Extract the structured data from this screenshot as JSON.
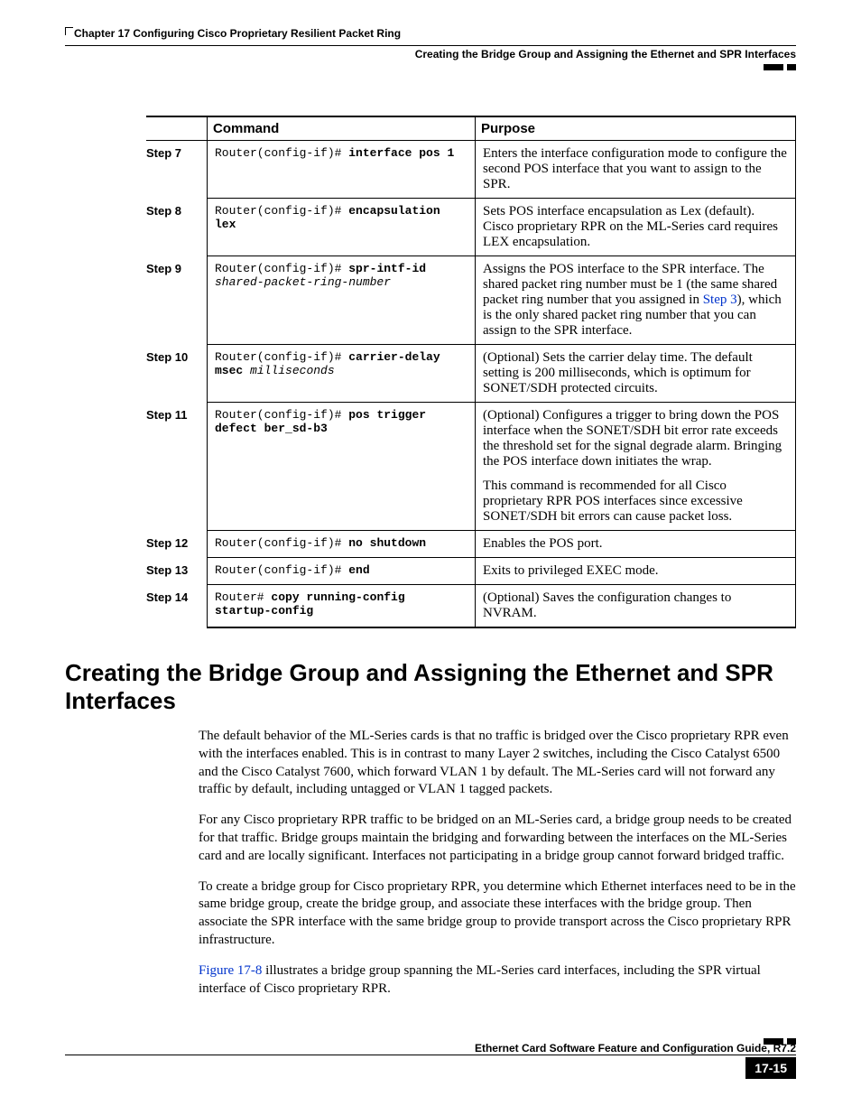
{
  "header": {
    "chapter": "Chapter 17    Configuring Cisco Proprietary Resilient Packet Ring",
    "section": "Creating the Bridge Group and Assigning the Ethernet and SPR Interfaces"
  },
  "table": {
    "headers": {
      "command": "Command",
      "purpose": "Purpose"
    },
    "steps": [
      {
        "step": "Step 7",
        "prompt": "Router(config-if)# ",
        "bold": "interface pos 1",
        "italic": "",
        "purpose": "Enters the interface configuration mode to configure the second POS interface that you want to assign to the SPR."
      },
      {
        "step": "Step 8",
        "prompt": "Router(config-if)# ",
        "bold": "encapsulation lex",
        "italic": "",
        "purpose": "Sets POS interface encapsulation as Lex (default). Cisco proprietary RPR on the ML-Series card requires LEX encapsulation."
      },
      {
        "step": "Step 9",
        "prompt": "Router(config-if)# ",
        "bold": "spr-intf-id",
        "italic": "shared-packet-ring-number",
        "purpose_parts": {
          "pre": "Assigns the POS interface to the SPR interface. The shared packet ring number must be 1 (the same shared packet ring number that you assigned in ",
          "link": "Step 3",
          "post": "), which is the only shared packet ring number that you can assign to the SPR interface."
        }
      },
      {
        "step": "Step 10",
        "prompt": "Router(config-if)# ",
        "bold": "carrier-delay msec",
        "italic": "milliseconds",
        "purpose": "(Optional) Sets the carrier delay time. The default setting is 200 milliseconds, which is optimum for SONET/SDH protected circuits."
      },
      {
        "step": "Step 11",
        "prompt": "Router(config-if)# ",
        "bold": "pos trigger defect ber_sd-b3",
        "italic": "",
        "purpose": "(Optional) Configures a trigger to bring down the POS interface when the SONET/SDH bit error rate exceeds the threshold set for the signal degrade alarm. Bringing the POS interface down initiates the wrap.",
        "purpose2": "This command is recommended for all Cisco proprietary RPR POS interfaces since excessive SONET/SDH bit errors can cause packet loss."
      },
      {
        "step": "Step 12",
        "prompt": "Router(config-if)# ",
        "bold": "no shutdown",
        "italic": "",
        "purpose": "Enables the POS port."
      },
      {
        "step": "Step 13",
        "prompt": "Router(config-if)# ",
        "bold": "end",
        "italic": "",
        "purpose": "Exits to privileged EXEC mode."
      },
      {
        "step": "Step 14",
        "prompt": "Router# ",
        "bold": "copy running-config startup-config",
        "italic": "",
        "purpose": "(Optional) Saves the configuration changes to NVRAM."
      }
    ]
  },
  "heading": "Creating the Bridge Group and Assigning the Ethernet and SPR Interfaces",
  "paragraphs": {
    "p1": "The default behavior of the ML-Series cards is that no traffic is bridged over the Cisco proprietary RPR even with the interfaces enabled. This is in contrast to many Layer 2 switches, including the Cisco Catalyst 6500 and the Cisco Catalyst 7600, which forward VLAN 1 by default. The ML-Series card will not forward any traffic by default, including untagged or VLAN 1 tagged packets.",
    "p2": "For any Cisco proprietary RPR traffic to be bridged on an ML-Series card, a bridge group needs to be created for that traffic. Bridge groups maintain the bridging and forwarding between the interfaces on the ML-Series card and are locally significant. Interfaces not participating in a bridge group cannot forward bridged traffic.",
    "p3": "To create a bridge group for Cisco proprietary RPR, you determine which Ethernet interfaces need to be in the same bridge group, create the bridge group, and associate these interfaces with the bridge group. Then associate the SPR interface with the same bridge group to provide transport across the Cisco proprietary RPR infrastructure.",
    "p4_link": "Figure 17-8",
    "p4_rest": " illustrates a bridge group spanning the ML-Series card interfaces, including the SPR virtual interface of Cisco proprietary RPR."
  },
  "footer": {
    "guide": "Ethernet Card Software Feature and Configuration Guide, R7.2",
    "page": "17-15"
  }
}
